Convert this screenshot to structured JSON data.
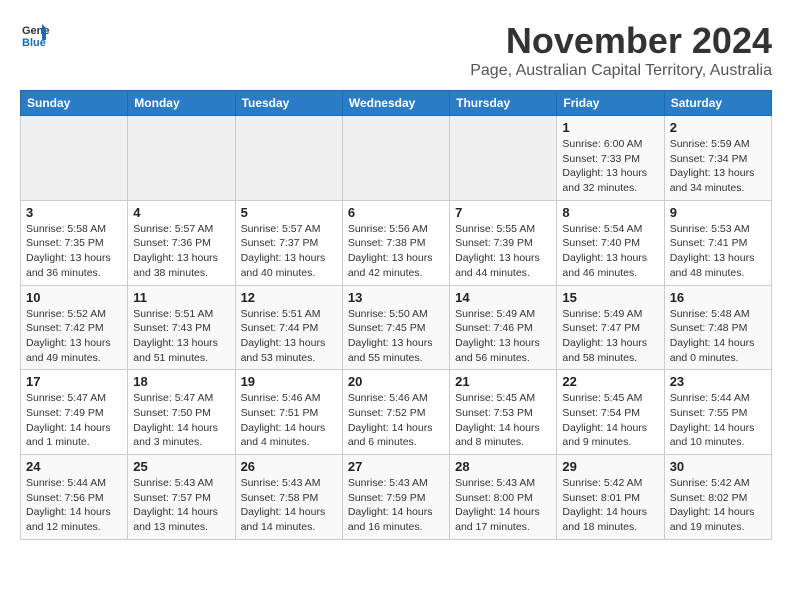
{
  "header": {
    "logo_line1": "General",
    "logo_line2": "Blue",
    "month": "November 2024",
    "location": "Page, Australian Capital Territory, Australia"
  },
  "weekdays": [
    "Sunday",
    "Monday",
    "Tuesday",
    "Wednesday",
    "Thursday",
    "Friday",
    "Saturday"
  ],
  "weeks": [
    [
      {
        "day": "",
        "detail": ""
      },
      {
        "day": "",
        "detail": ""
      },
      {
        "day": "",
        "detail": ""
      },
      {
        "day": "",
        "detail": ""
      },
      {
        "day": "",
        "detail": ""
      },
      {
        "day": "1",
        "detail": "Sunrise: 6:00 AM\nSunset: 7:33 PM\nDaylight: 13 hours\nand 32 minutes."
      },
      {
        "day": "2",
        "detail": "Sunrise: 5:59 AM\nSunset: 7:34 PM\nDaylight: 13 hours\nand 34 minutes."
      }
    ],
    [
      {
        "day": "3",
        "detail": "Sunrise: 5:58 AM\nSunset: 7:35 PM\nDaylight: 13 hours\nand 36 minutes."
      },
      {
        "day": "4",
        "detail": "Sunrise: 5:57 AM\nSunset: 7:36 PM\nDaylight: 13 hours\nand 38 minutes."
      },
      {
        "day": "5",
        "detail": "Sunrise: 5:57 AM\nSunset: 7:37 PM\nDaylight: 13 hours\nand 40 minutes."
      },
      {
        "day": "6",
        "detail": "Sunrise: 5:56 AM\nSunset: 7:38 PM\nDaylight: 13 hours\nand 42 minutes."
      },
      {
        "day": "7",
        "detail": "Sunrise: 5:55 AM\nSunset: 7:39 PM\nDaylight: 13 hours\nand 44 minutes."
      },
      {
        "day": "8",
        "detail": "Sunrise: 5:54 AM\nSunset: 7:40 PM\nDaylight: 13 hours\nand 46 minutes."
      },
      {
        "day": "9",
        "detail": "Sunrise: 5:53 AM\nSunset: 7:41 PM\nDaylight: 13 hours\nand 48 minutes."
      }
    ],
    [
      {
        "day": "10",
        "detail": "Sunrise: 5:52 AM\nSunset: 7:42 PM\nDaylight: 13 hours\nand 49 minutes."
      },
      {
        "day": "11",
        "detail": "Sunrise: 5:51 AM\nSunset: 7:43 PM\nDaylight: 13 hours\nand 51 minutes."
      },
      {
        "day": "12",
        "detail": "Sunrise: 5:51 AM\nSunset: 7:44 PM\nDaylight: 13 hours\nand 53 minutes."
      },
      {
        "day": "13",
        "detail": "Sunrise: 5:50 AM\nSunset: 7:45 PM\nDaylight: 13 hours\nand 55 minutes."
      },
      {
        "day": "14",
        "detail": "Sunrise: 5:49 AM\nSunset: 7:46 PM\nDaylight: 13 hours\nand 56 minutes."
      },
      {
        "day": "15",
        "detail": "Sunrise: 5:49 AM\nSunset: 7:47 PM\nDaylight: 13 hours\nand 58 minutes."
      },
      {
        "day": "16",
        "detail": "Sunrise: 5:48 AM\nSunset: 7:48 PM\nDaylight: 14 hours\nand 0 minutes."
      }
    ],
    [
      {
        "day": "17",
        "detail": "Sunrise: 5:47 AM\nSunset: 7:49 PM\nDaylight: 14 hours\nand 1 minute."
      },
      {
        "day": "18",
        "detail": "Sunrise: 5:47 AM\nSunset: 7:50 PM\nDaylight: 14 hours\nand 3 minutes."
      },
      {
        "day": "19",
        "detail": "Sunrise: 5:46 AM\nSunset: 7:51 PM\nDaylight: 14 hours\nand 4 minutes."
      },
      {
        "day": "20",
        "detail": "Sunrise: 5:46 AM\nSunset: 7:52 PM\nDaylight: 14 hours\nand 6 minutes."
      },
      {
        "day": "21",
        "detail": "Sunrise: 5:45 AM\nSunset: 7:53 PM\nDaylight: 14 hours\nand 8 minutes."
      },
      {
        "day": "22",
        "detail": "Sunrise: 5:45 AM\nSunset: 7:54 PM\nDaylight: 14 hours\nand 9 minutes."
      },
      {
        "day": "23",
        "detail": "Sunrise: 5:44 AM\nSunset: 7:55 PM\nDaylight: 14 hours\nand 10 minutes."
      }
    ],
    [
      {
        "day": "24",
        "detail": "Sunrise: 5:44 AM\nSunset: 7:56 PM\nDaylight: 14 hours\nand 12 minutes."
      },
      {
        "day": "25",
        "detail": "Sunrise: 5:43 AM\nSunset: 7:57 PM\nDaylight: 14 hours\nand 13 minutes."
      },
      {
        "day": "26",
        "detail": "Sunrise: 5:43 AM\nSunset: 7:58 PM\nDaylight: 14 hours\nand 14 minutes."
      },
      {
        "day": "27",
        "detail": "Sunrise: 5:43 AM\nSunset: 7:59 PM\nDaylight: 14 hours\nand 16 minutes."
      },
      {
        "day": "28",
        "detail": "Sunrise: 5:43 AM\nSunset: 8:00 PM\nDaylight: 14 hours\nand 17 minutes."
      },
      {
        "day": "29",
        "detail": "Sunrise: 5:42 AM\nSunset: 8:01 PM\nDaylight: 14 hours\nand 18 minutes."
      },
      {
        "day": "30",
        "detail": "Sunrise: 5:42 AM\nSunset: 8:02 PM\nDaylight: 14 hours\nand 19 minutes."
      }
    ]
  ]
}
